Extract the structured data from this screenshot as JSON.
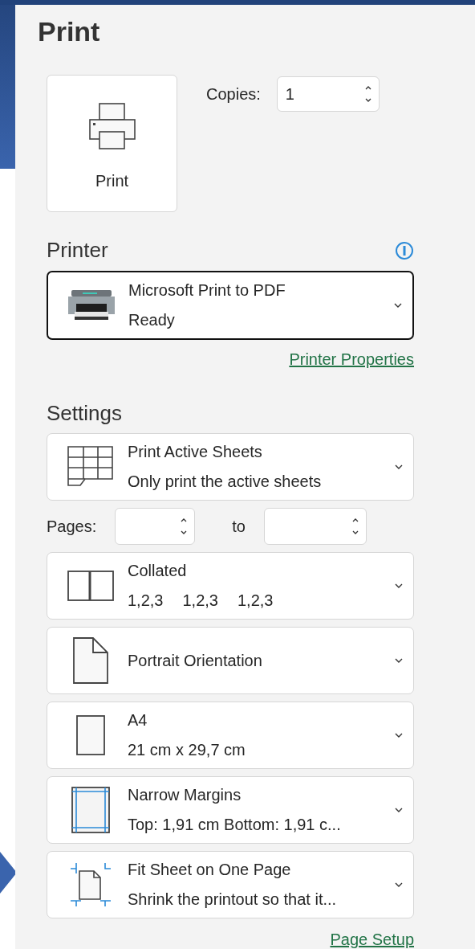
{
  "title": "Print",
  "print_button": {
    "label": "Print"
  },
  "copies": {
    "label": "Copies:",
    "value": "1"
  },
  "printer": {
    "heading": "Printer",
    "name": "Microsoft Print to PDF",
    "status": "Ready",
    "focused": true,
    "properties_link": "Printer Properties"
  },
  "settings": {
    "heading": "Settings",
    "items": [
      {
        "kind": "dropdown",
        "title": "Print Active Sheets",
        "subtitle": "Only print the active sheets"
      },
      {
        "kind": "pages",
        "label": "Pages:",
        "to": "to"
      },
      {
        "kind": "dropdown",
        "title": "Collated",
        "subtitle_parts": [
          "1,2,3",
          "1,2,3",
          "1,2,3"
        ]
      },
      {
        "kind": "dropdown",
        "title": "Portrait Orientation"
      },
      {
        "kind": "dropdown",
        "title": "A4",
        "subtitle": "21 cm x 29,7 cm"
      },
      {
        "kind": "dropdown",
        "title": "Narrow Margins",
        "subtitle": "Top: 1,91 cm Bottom: 1,91 c..."
      },
      {
        "kind": "dropdown",
        "title": "Fit Sheet on One Page",
        "subtitle": "Shrink the printout so that it..."
      }
    ],
    "page_setup_link": "Page Setup"
  }
}
